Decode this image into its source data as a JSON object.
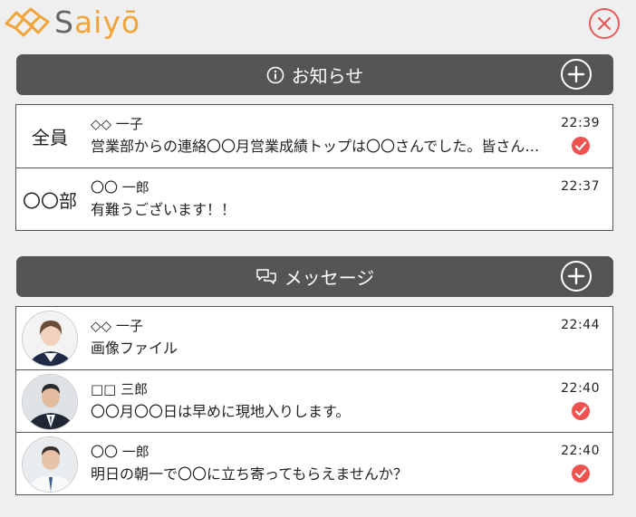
{
  "app": {
    "logo_text": "Saiyō",
    "logo_s": "S",
    "logo_rest": "aiyō"
  },
  "colors": {
    "accent": "#f0a43a",
    "close": "#e85a5a",
    "check": "#ef5350",
    "bar": "#555555"
  },
  "notices": {
    "title": "お知らせ",
    "icon": "info-icon",
    "items": [
      {
        "group": "全員",
        "sender": "◇◇ 一子",
        "text": "営業部からの連絡〇〇月営業成績トップは〇〇さんでした。皆さん…",
        "time": "22:39",
        "read": true
      },
      {
        "group": "〇〇部",
        "sender": "〇〇 一郎",
        "text": "有難うございます！！",
        "time": "22:37",
        "read": false
      }
    ]
  },
  "messages": {
    "title": "メッセージ",
    "icon": "chat-icon",
    "items": [
      {
        "sender": "◇◇ 一子",
        "text": "画像ファイル",
        "time": "22:44",
        "read": false,
        "avatar": "woman-photo"
      },
      {
        "sender": "□□ 三郎",
        "text": "〇〇月〇〇日は早めに現地入りします。",
        "time": "22:40",
        "read": true,
        "avatar": "man-suit-photo"
      },
      {
        "sender": "〇〇 一郎",
        "text": "明日の朝一で〇〇に立ち寄ってもらえませんか？",
        "time": "22:40",
        "read": true,
        "avatar": "man-shirt-photo"
      }
    ]
  }
}
